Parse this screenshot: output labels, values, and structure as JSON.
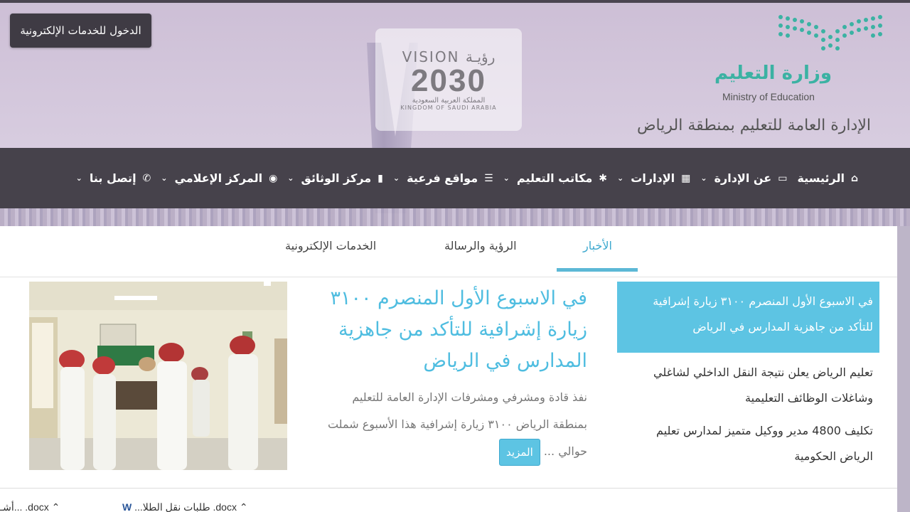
{
  "header": {
    "eservices_login": "الدخول للخدمات الإلكترونية",
    "vision": {
      "label": "VISION",
      "label_ar": "رؤيـة",
      "year": "2030",
      "country_ar": "المملكة العربية السعودية",
      "country_en": "KINGDOM OF SAUDI ARABIA"
    },
    "ministry_ar": "وزارة التعليم",
    "ministry_en": "Ministry of Education",
    "region": "الإدارة العامة للتعليم بمنطقة الرياض"
  },
  "nav": {
    "items": [
      {
        "label": "الرئيسية",
        "icon": "home-icon",
        "has_dropdown": false
      },
      {
        "label": "عن الإدارة",
        "icon": "monitor-icon",
        "has_dropdown": true
      },
      {
        "label": "الإدارات",
        "icon": "grid-icon",
        "has_dropdown": true
      },
      {
        "label": "مكاتب التعليم",
        "icon": "asterisk-icon",
        "has_dropdown": true
      },
      {
        "label": "مواقع فرعية",
        "icon": "list-icon",
        "has_dropdown": true
      },
      {
        "label": "مركز الوثائق",
        "icon": "file-icon",
        "has_dropdown": true
      },
      {
        "label": "المركز الإعلامي",
        "icon": "eye-icon",
        "has_dropdown": true
      },
      {
        "label": "إتصل بنا",
        "icon": "phone-icon",
        "has_dropdown": true
      }
    ]
  },
  "tabs": {
    "news": "الأخبار",
    "vision_mission": "الرؤية والرسالة",
    "eservices": "الخدمات الإلكترونية",
    "active": "news"
  },
  "news_list": [
    {
      "title": "في الاسبوع الأول المنصرم ٣١٠٠ زيارة إشرافية للتأكد من جاهزية المدارس في الرياض",
      "active": true
    },
    {
      "title": "تعليم الرياض يعلن نتيجة النقل الداخلي لشاغلي وشاغلات الوظائف التعليمية",
      "active": false
    },
    {
      "title": "تكليف 4800 مدير ووكيل متميز لمدارس تعليم الرياض الحكومية",
      "active": false
    }
  ],
  "feature": {
    "title": "في الاسبوع الأول المنصرم ٣١٠٠ زيارة إشرافية للتأكد من جاهزية المدارس في الرياض",
    "excerpt": "نفذ قادة ومشرفي ومشرفات الإدارة العامة للتعليم بمنطقة الرياض ٣١٠٠ زيارة إشرافية هذا الأسبوع شملت حوالي ...",
    "more": "المزيد"
  },
  "downloads": [
    {
      "name": ".docx",
      "suffix": "أشـ...",
      "icon": "word-doc-icon"
    },
    {
      "name": ".docx",
      "suffix": "...طلبات نقل الطلا",
      "icon": "word-doc-icon"
    }
  ],
  "colors": {
    "navbar": "#46424b",
    "accent": "#5dc4e3",
    "accent_text": "#4fbde0",
    "ministry_green": "#3bb2a3"
  }
}
